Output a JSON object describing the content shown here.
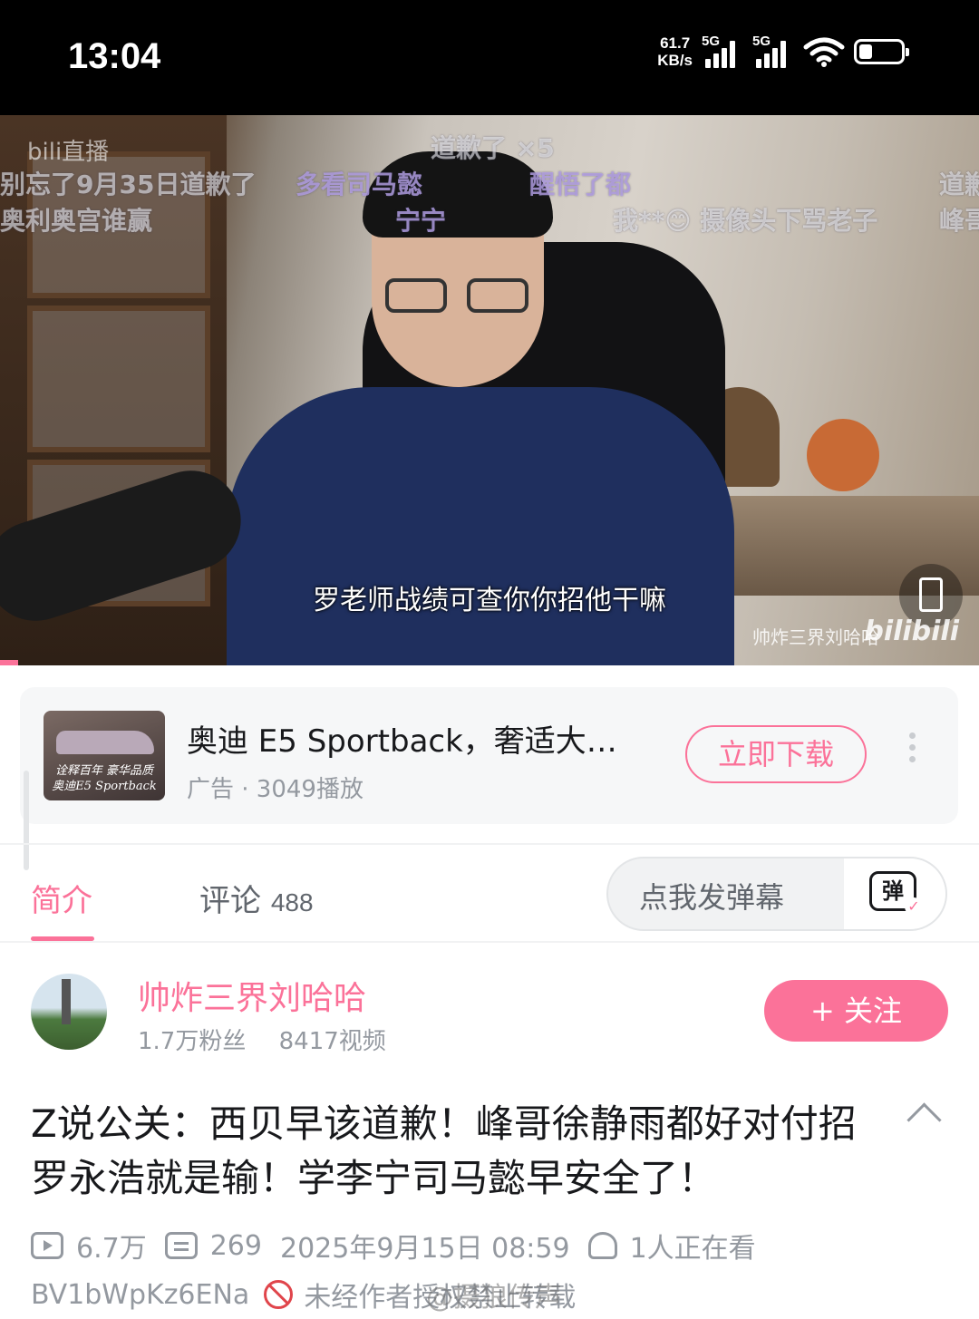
{
  "status_bar": {
    "time": "13:04",
    "net_speed_value": "61.7",
    "net_speed_unit": "KB/s",
    "signal1_label": "5G",
    "signal2_label": "5G",
    "icons": [
      "signal-icon",
      "signal-icon",
      "wifi-icon",
      "battery-icon"
    ]
  },
  "video": {
    "live_tag": "bili直播",
    "danmaku": [
      "道歉了 ×5",
      "别忘了9月35日道歉了",
      "多看司马懿",
      "醒悟了都",
      "我**😊 摄像头下骂老子",
      "道歉",
      "峰哥",
      "奥利奥宫谁赢",
      "宁宁"
    ],
    "subtitle": "罗老师战绩可查你你招他干嘛",
    "watermark": "帅炸三界刘哈哈",
    "logo": "bilibili"
  },
  "ad": {
    "thumb_caption_line1": "诠释百年 豪华品质",
    "thumb_caption_line2": "奥迪E5 Sportback",
    "title": "奥迪 E5 Sportback，奢适大…",
    "meta": "广告 · 3049播放",
    "button": "立即下载"
  },
  "tabs": {
    "intro": "简介",
    "comments": "评论",
    "comments_count": "488"
  },
  "danmu_input": {
    "placeholder": "点我发弹幕",
    "icon_text": "弹"
  },
  "uploader": {
    "name": "帅炸三界刘哈哈",
    "fans": "1.7万粉丝",
    "videos": "8417视频",
    "follow": "+ 关注"
  },
  "video_info": {
    "title": "Z说公关：西贝早该道歉！峰哥徐静雨都好对付招罗永浩就是输！学李宁司马懿早安全了！",
    "views": "6.7万",
    "danmaku_count": "269",
    "date": "2025年9月15日 08:59",
    "watching": "1人正在看",
    "bvid": "BV1bWpKz6ENa",
    "no_repost": "未经作者授权禁止转载",
    "weibo_watermark": "@摄狼传声"
  },
  "colors": {
    "accent": "#fb7299",
    "text_primary": "#18191c",
    "text_secondary": "#9499a0"
  }
}
